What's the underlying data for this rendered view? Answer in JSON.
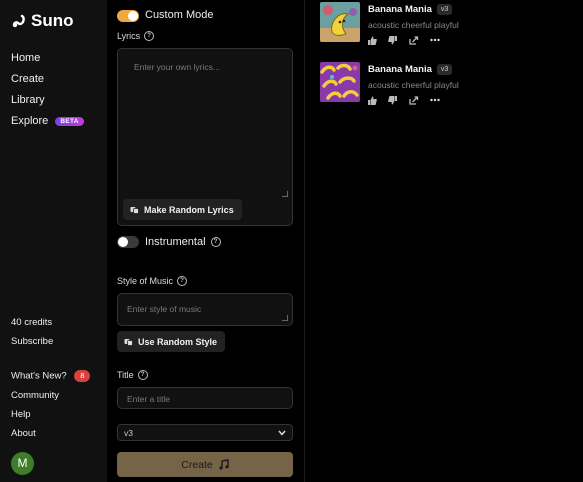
{
  "app": {
    "logo_text": "Suno"
  },
  "sidebar": {
    "nav": [
      {
        "label": "Home"
      },
      {
        "label": "Create"
      },
      {
        "label": "Library"
      },
      {
        "label": "Explore",
        "badge": "BETA"
      }
    ],
    "credits": "40 credits",
    "subscribe": "Subscribe",
    "whats_new": "What's New?",
    "whats_new_count": "8",
    "community": "Community",
    "help": "Help",
    "about": "About",
    "avatar_initial": "M",
    "avatar_color": "#3f7d2a"
  },
  "form": {
    "custom_mode_label": "Custom Mode",
    "custom_mode_on": true,
    "lyrics_label": "Lyrics",
    "lyrics_placeholder": "Enter your own lyrics...",
    "random_lyrics_button": "Make Random Lyrics",
    "instrumental_label": "Instrumental",
    "instrumental_on": false,
    "style_label": "Style of Music",
    "style_placeholder": "Enter style of music",
    "random_style_button": "Use Random Style",
    "title_label": "Title",
    "title_placeholder": "Enter a title",
    "model_selected": "v3",
    "create_button": "Create",
    "accent_color": "#f0a840",
    "create_color": "#756447"
  },
  "songs": [
    {
      "title": "Banana Mania",
      "version": "v3",
      "tags": "acoustic cheerful playful"
    },
    {
      "title": "Banana Mania",
      "version": "v3",
      "tags": "acoustic cheerful playful"
    }
  ]
}
